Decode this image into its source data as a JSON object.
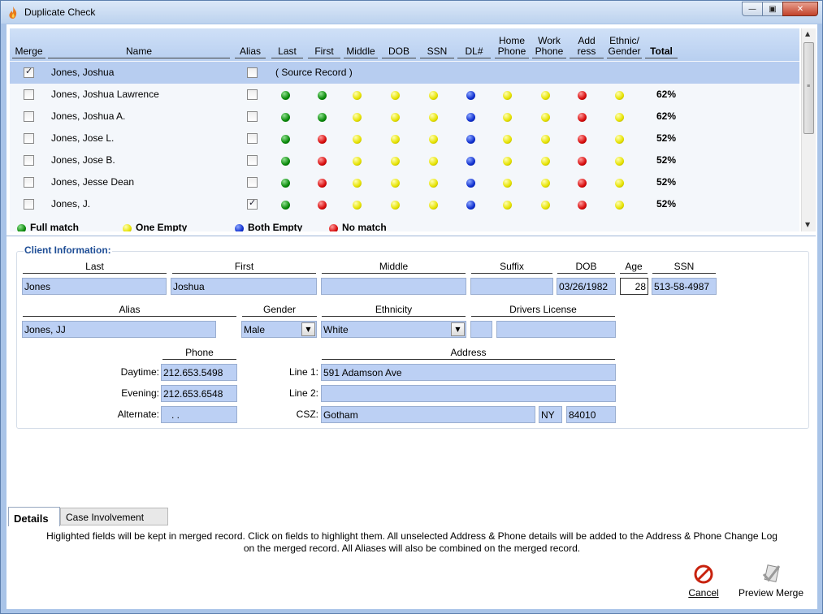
{
  "window": {
    "title": "Duplicate Check",
    "min_glyph": "—",
    "max_glyph": "▣",
    "close_glyph": "✕"
  },
  "grid": {
    "headers": [
      "Merge",
      "Name",
      "Alias",
      "Last",
      "First",
      "Middle",
      "DOB",
      "SSN",
      "DL#",
      "Home Phone",
      "Work Phone",
      "Add ress",
      "Ethnic/ Gender",
      "Total"
    ],
    "header_lines": {
      "home": [
        "Home",
        "Phone"
      ],
      "work": [
        "Work",
        "Phone"
      ],
      "address": [
        "Add",
        "ress"
      ],
      "ethnic": [
        "Ethnic/",
        "Gender"
      ]
    },
    "source_label": "( Source Record )",
    "rows": [
      {
        "name": "Jones, Joshua",
        "merge": true,
        "alias": false,
        "source": true,
        "dots": [],
        "total": ""
      },
      {
        "name": "Jones, Joshua Lawrence",
        "merge": false,
        "alias": false,
        "source": false,
        "dots": [
          "green",
          "green",
          "yellow",
          "yellow",
          "yellow",
          "blue",
          "yellow",
          "yellow",
          "red",
          "yellow"
        ],
        "total": "62%"
      },
      {
        "name": "Jones, Joshua A.",
        "merge": false,
        "alias": false,
        "source": false,
        "dots": [
          "green",
          "green",
          "yellow",
          "yellow",
          "yellow",
          "blue",
          "yellow",
          "yellow",
          "red",
          "yellow"
        ],
        "total": "62%"
      },
      {
        "name": "Jones, Jose L.",
        "merge": false,
        "alias": false,
        "source": false,
        "dots": [
          "green",
          "red",
          "yellow",
          "yellow",
          "yellow",
          "blue",
          "yellow",
          "yellow",
          "red",
          "yellow"
        ],
        "total": "52%"
      },
      {
        "name": "Jones, Jose B.",
        "merge": false,
        "alias": false,
        "source": false,
        "dots": [
          "green",
          "red",
          "yellow",
          "yellow",
          "yellow",
          "blue",
          "yellow",
          "yellow",
          "red",
          "yellow"
        ],
        "total": "52%"
      },
      {
        "name": "Jones, Jesse Dean",
        "merge": false,
        "alias": false,
        "source": false,
        "dots": [
          "green",
          "red",
          "yellow",
          "yellow",
          "yellow",
          "blue",
          "yellow",
          "yellow",
          "red",
          "yellow"
        ],
        "total": "52%"
      },
      {
        "name": "Jones, J.",
        "merge": false,
        "alias": true,
        "source": false,
        "dots": [
          "green",
          "red",
          "yellow",
          "yellow",
          "yellow",
          "blue",
          "yellow",
          "yellow",
          "red",
          "yellow"
        ],
        "total": "52%"
      }
    ],
    "legend": [
      {
        "color": "green",
        "label": "Full match"
      },
      {
        "color": "yellow",
        "label": "One Empty"
      },
      {
        "color": "blue",
        "label": "Both Empty"
      },
      {
        "color": "red",
        "label": "No match"
      }
    ]
  },
  "client": {
    "title": "Client Information:",
    "labels": {
      "last": "Last",
      "first": "First",
      "middle": "Middle",
      "suffix": "Suffix",
      "dob": "DOB",
      "age": "Age",
      "ssn": "SSN",
      "alias": "Alias",
      "gender": "Gender",
      "ethnicity": "Ethnicity",
      "drivers_license": "Drivers License",
      "phone": "Phone",
      "address": "Address",
      "daytime": "Daytime:",
      "evening": "Evening:",
      "alternate": "Alternate:",
      "line1": "Line 1:",
      "line2": "Line 2:",
      "csz": "CSZ:"
    },
    "values": {
      "last": "Jones",
      "first": "Joshua",
      "middle": "",
      "suffix": "",
      "dob": "03/26/1982",
      "age": "28",
      "ssn": "513-58-4987",
      "alias": "Jones, JJ",
      "gender": "Male",
      "ethnicity": "White",
      "dl_state": "",
      "dl_number": "",
      "daytime": "212.653.5498",
      "evening": "212.653.6548",
      "alternate": ".   .",
      "line1": "591 Adamson Ave",
      "line2": "",
      "city": "Gotham",
      "state": "NY",
      "zip": "84010"
    }
  },
  "tabs": {
    "details": "Details",
    "case_involvement": "Case Involvement"
  },
  "hint": {
    "line1": "Higlighted fields will be kept in merged record.  Click on fields to highlight them.  All unselected Address & Phone details will be added to the Address & Phone Change Log",
    "line2": "on the merged record. All Aliases will also be combined on the merged record."
  },
  "actions": {
    "cancel": "Cancel",
    "preview": "Preview Merge"
  },
  "colors": {
    "accent": "#1f4e96",
    "field_bg": "#bcd0f4",
    "selected_row": "#b7cdf0"
  }
}
